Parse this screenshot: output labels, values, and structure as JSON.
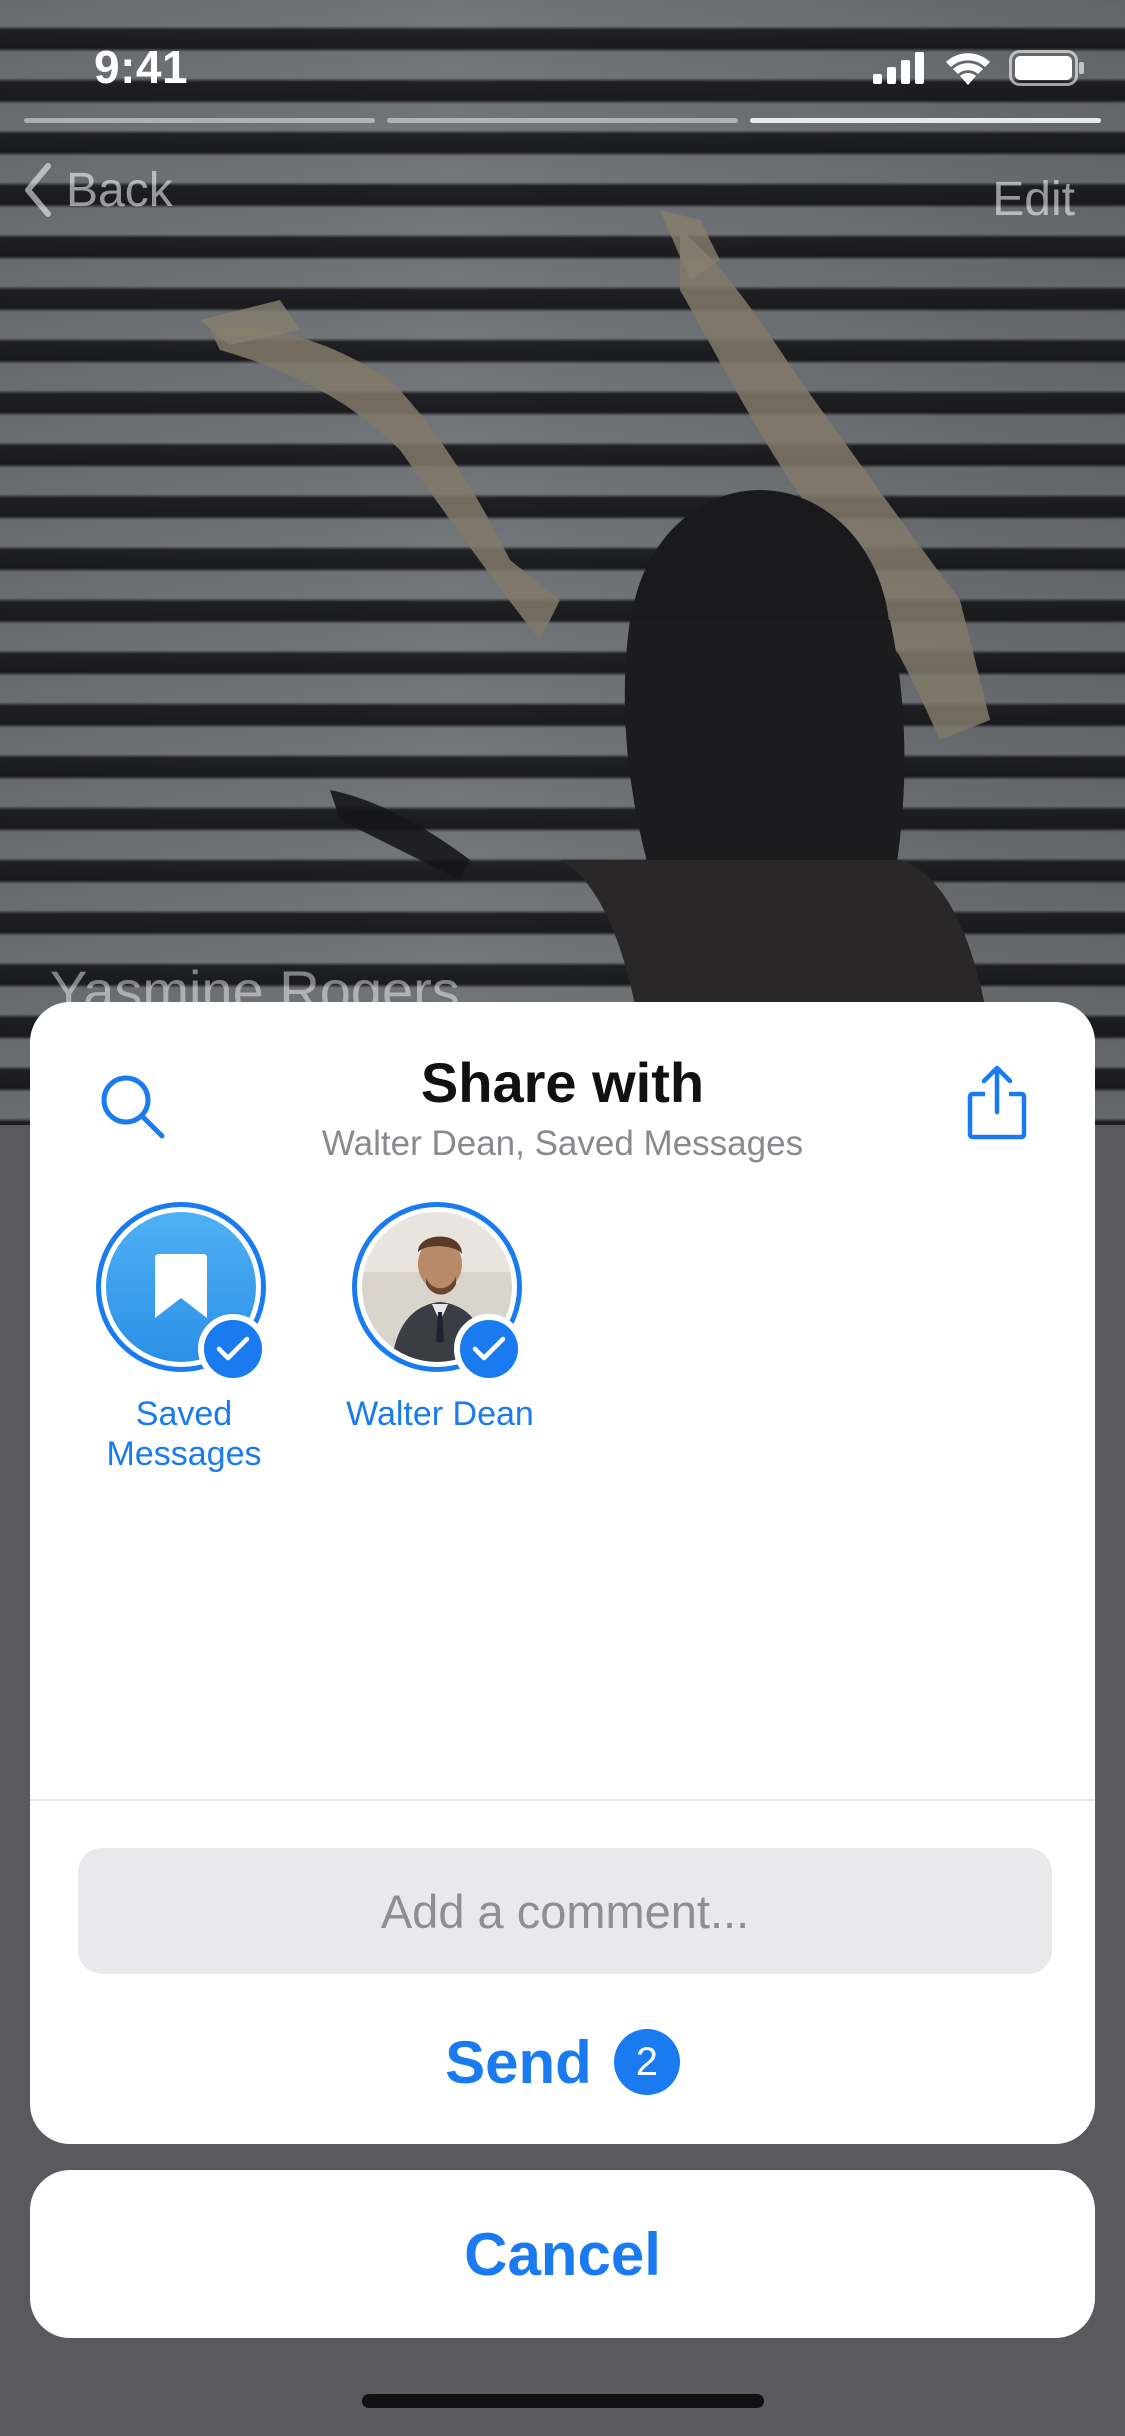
{
  "status_bar": {
    "time": "9:41",
    "icons": [
      "cellular-signal-icon",
      "wifi-icon",
      "battery-icon"
    ]
  },
  "story": {
    "progress_segments": 3,
    "active_segment": 3
  },
  "nav": {
    "back_label": "Back",
    "edit_label": "Edit"
  },
  "background": {
    "name": "Yasmine Rogers"
  },
  "share_sheet": {
    "title": "Share with",
    "subtitle": "Walter Dean, Saved Messages",
    "search_icon": "search-icon",
    "share_icon": "share-icon",
    "recipients": [
      {
        "label_line1": "Saved",
        "label_line2": "Messages",
        "icon": "bookmark-icon",
        "selected": true
      },
      {
        "label_line1": "Walter Dean",
        "label_line2": "",
        "icon": "avatar",
        "selected": true
      }
    ],
    "comment_placeholder": "Add a comment...",
    "send_label": "Send",
    "send_count": "2"
  },
  "cancel_label": "Cancel",
  "colors": {
    "accent": "#1a7bf0",
    "sheet_bg": "#ffffff",
    "input_bg": "#e9e9eb",
    "subtitle": "#8a8a8e"
  }
}
